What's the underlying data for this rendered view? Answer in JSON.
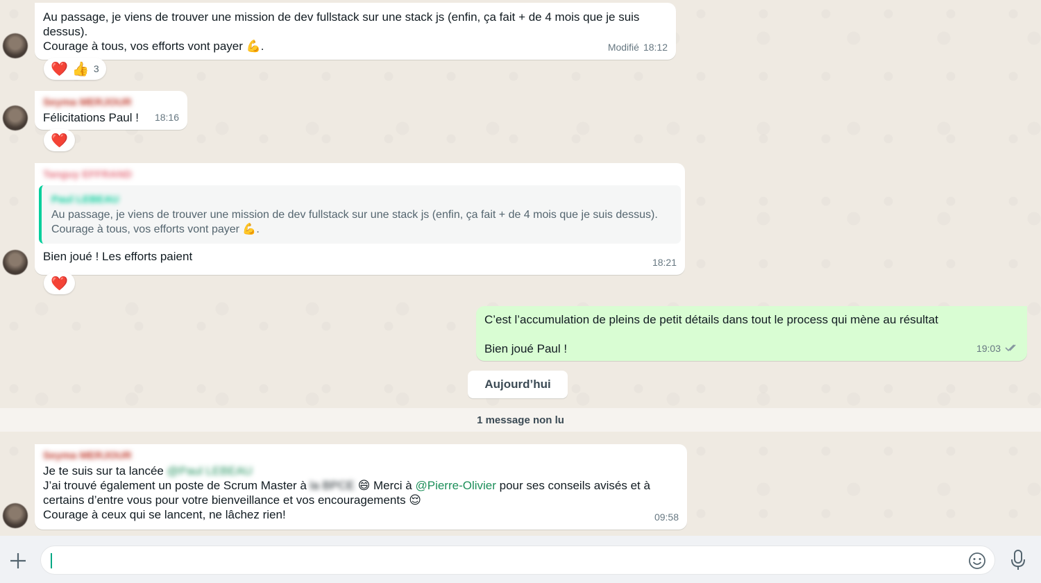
{
  "messages": [
    {
      "id": "m1",
      "lines": [
        "Au passage, je viens de trouver une mission de dev fullstack sur une stack js (enfin, ça fait + de 4 mois que je suis",
        "dessus).",
        "Courage à tous, vos efforts vont payer 💪."
      ],
      "edited_label": "Modifié",
      "time": "18:12",
      "reactions": {
        "emoji1": "❤️",
        "emoji2": "👍",
        "count": "3"
      }
    },
    {
      "id": "m2",
      "sender": "Seyma MERJOUR",
      "text": "Félicitations Paul !",
      "time": "18:16",
      "reactions": {
        "emoji1": "❤️"
      }
    },
    {
      "id": "m3",
      "sender": "Tanguy EFFRAND",
      "quote": {
        "name": "Paul LEBEAU",
        "lines": [
          "Au passage, je viens de trouver une mission de dev fullstack sur une stack js (enfin, ça fait + de 4 mois que je suis dessus).",
          "Courage à tous, vos efforts vont payer 💪."
        ]
      },
      "text": "Bien joué ! Les efforts paient",
      "time": "18:21",
      "reactions": {
        "emoji1": "❤️"
      }
    },
    {
      "id": "m4",
      "outgoing": true,
      "line1": "C’est l’accumulation de pleins de petit détails dans tout le process qui mène au résultat",
      "line2": "Bien joué Paul !",
      "time": "19:03",
      "status_icon": "double-check-icon"
    },
    {
      "id": "m5",
      "sender": "Seyma MERJOUR",
      "line1_prefix": "Je te suis sur ta lancée ",
      "mention1": "@Paul LEBEAU",
      "line2_prefix": "J’ai trouvé également un poste de Scrum Master à ",
      "company": "la BPCE",
      "line2_emoji": " 😄 Merci à ",
      "mention2": "@Pierre-Olivier",
      "line2_suffix": " pour ses conseils avisés et à",
      "line3": "certains d’entre vous pour votre bienveillance et vos encouragements 😌",
      "line4": "Courage à ceux qui se lancent, ne lâchez rien!",
      "time": "09:58"
    }
  ],
  "date_chip": "Aujourd’hui",
  "unread_banner": "1 message non lu",
  "composer": {
    "placeholder": "",
    "plus_icon": "plus-icon",
    "emoji_icon": "emoji-icon",
    "mic_icon": "microphone-icon"
  },
  "colors": {
    "chat_bg": "#efeae2",
    "outgoing_bubble": "#d9fdd3",
    "accent": "#00a884"
  }
}
